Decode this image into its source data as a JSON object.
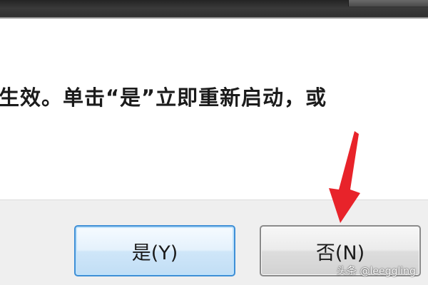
{
  "dialog": {
    "message": "生效。单击“是”立即重新启动，或",
    "yes_label": "是(Y)",
    "no_label": "否(N)"
  },
  "annotation": {
    "arrow_color": "#e8232a"
  },
  "watermark": {
    "text": "头条 @leeggling"
  },
  "colors": {
    "titlebar": "#2e2e2e",
    "content_bg": "#ffffff",
    "footer_bg": "#efefef",
    "focused_button_border": "#3e8fd6",
    "button_border": "#8a8a8a"
  }
}
